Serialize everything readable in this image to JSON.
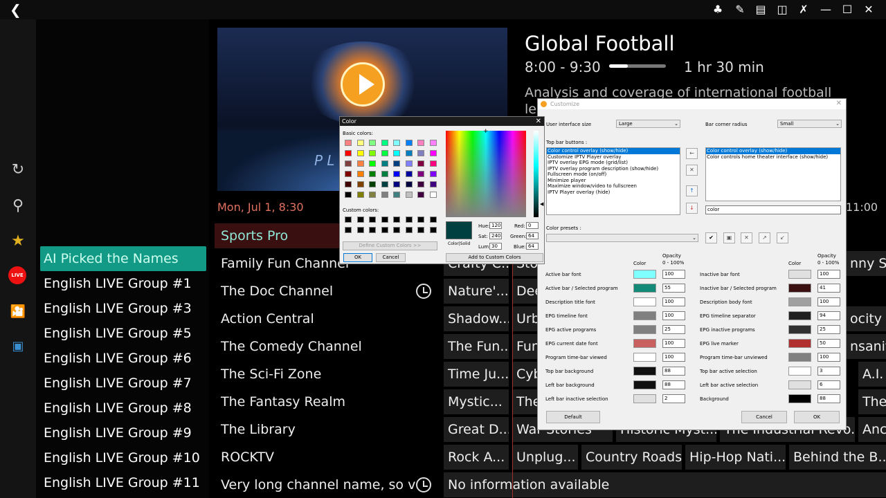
{
  "topbar": {
    "back_icon": "chevron-left-icon",
    "icons": [
      "people-icon",
      "brush-icon",
      "grid-slash-icon",
      "program-icon",
      "shrink-icon",
      "minimize-icon",
      "maximize-icon",
      "close-icon"
    ]
  },
  "leftbar": {
    "icons": [
      "refresh-icon",
      "search-icon",
      "star-icon",
      "live-icon",
      "movies-icon",
      "tv-icon"
    ],
    "live_label": "LIVE"
  },
  "groups": [
    "AI Picked the Names",
    "English LIVE Group #1",
    "English LIVE Group #3",
    "English LIVE Group #5",
    "English LIVE Group #6",
    "English LIVE Group #7",
    "English LIVE Group #8",
    "English LIVE Group #9",
    "English LIVE Group #10",
    "English LIVE Group #11"
  ],
  "program": {
    "title": "Global Football",
    "time": "8:00 - 9:30",
    "duration": "1 hr 30 min",
    "progress": 0.33,
    "description": "Analysis and coverage of international football leagues ar"
  },
  "video": {
    "logo_text": "Z",
    "logo_text2": "P L"
  },
  "epg": {
    "date": "Mon, Jul 1, 8:30",
    "right_time": "11:00",
    "channels": [
      "Sports Pro",
      "Family Fun Channel",
      "The Doc Channel",
      "Action Central",
      "The Comedy Channel",
      "The Sci-Fi Zone",
      "The Fantasy Realm",
      "The Library",
      "ROCKTV",
      "Very long channel name, so v..."
    ],
    "rows": [
      [
        "Crafty C...",
        "Sto",
        "nny Sid"
      ],
      [
        "Nature'...",
        "Dee"
      ],
      [
        "Shadow...",
        "Urb",
        "ocity R"
      ],
      [
        "The Fun...",
        "Fun",
        "nsanity"
      ],
      [
        "Time Ju...",
        "Cyb",
        "A.I."
      ],
      [
        "Mystic...",
        "The",
        "The"
      ],
      [
        "Great D...",
        "War Stories",
        "Historic Myst...",
        "The Industrial Revo...",
        "Anc"
      ],
      [
        "Rock A...",
        "Unplug...",
        "Country Roads",
        "Hip-Hop Nati...",
        "Behind the B..."
      ],
      [
        "No information available"
      ]
    ]
  },
  "colordlg": {
    "title": "Color",
    "basic_label": "Basic colors:",
    "custom_label": "Custom colors:",
    "define_btn": "Define Custom Colors >>",
    "ok": "OK",
    "cancel": "Cancel",
    "colorsolid": "Color|Solid",
    "hue_l": "Hue:",
    "hue": "120",
    "sat_l": "Sat:",
    "sat": "240",
    "lum_l": "Lum:",
    "lum": "30",
    "red_l": "Red:",
    "red": "0",
    "green_l": "Green:",
    "green": "64",
    "blue_l": "Blue:",
    "blue": "64",
    "add_btn": "Add to Custom Colors",
    "selected": "#004040",
    "basic": [
      "#ff8080",
      "#ffff80",
      "#80ff80",
      "#00ff80",
      "#80ffff",
      "#0080ff",
      "#ff80c0",
      "#ff80ff",
      "#ff0000",
      "#ffff00",
      "#80ff00",
      "#00ff40",
      "#00ffff",
      "#0080c0",
      "#8080c0",
      "#ff00ff",
      "#804040",
      "#ff8040",
      "#00ff00",
      "#008080",
      "#004080",
      "#8080ff",
      "#800040",
      "#ff0080",
      "#800000",
      "#ff8000",
      "#008000",
      "#008040",
      "#0000ff",
      "#0000a0",
      "#800080",
      "#8000ff",
      "#400000",
      "#804000",
      "#004000",
      "#004040",
      "#000080",
      "#000040",
      "#400040",
      "#400080",
      "#000000",
      "#808000",
      "#808040",
      "#808080",
      "#408080",
      "#c0c0c0",
      "#400040",
      "#ffffff"
    ]
  },
  "custdlg": {
    "title": "Customize",
    "ui_size_l": "User interface size",
    "ui_size": "Large",
    "corner_l": "Bar corner radius",
    "corner": "Small",
    "topbar_l": "Top bar buttons :",
    "avail": [
      "Color control overlay (show/hide)",
      "Customize IPTV Player overlay",
      "IPTV overlay EPG mode (grid/list)",
      "IPTV overlay program description (show/hide)",
      "Fullscreen mode (on/off)",
      "Minimize player",
      "Maximize window/video to fullscreen",
      "IPTV Player overlay (hide)"
    ],
    "chosen": [
      "Color control overlay (show/hide)",
      "Color controls home theater interface (show/hide)"
    ],
    "search": "color",
    "presets_l": "Color presets :",
    "color_h": "Color",
    "opacity_h": "Opacity",
    "opacity_sub": "0 - 100%",
    "left_rows": [
      [
        "Active bar font",
        "#80ffff",
        "100"
      ],
      [
        "Active bar / Selected program",
        "#138a78",
        "55"
      ],
      [
        "Description title font",
        "#ffffff",
        "100"
      ],
      [
        "EPG timeline font",
        "#808080",
        "100"
      ],
      [
        "EPG active programs",
        "#808080",
        "25"
      ],
      [
        "EPG current date font",
        "#c86060",
        "100"
      ],
      [
        "Program time-bar viewed",
        "#ffffff",
        "100"
      ],
      [
        "Top bar background",
        "#101010",
        "88"
      ],
      [
        "Left bar background",
        "#101010",
        "88"
      ],
      [
        "Left bar inactive selection",
        "#e0e0e0",
        "2"
      ]
    ],
    "right_rows": [
      [
        "Inactive bar font",
        "#e0e0e0",
        "100"
      ],
      [
        "Inactive bar / Selected program",
        "#3a1010",
        "41"
      ],
      [
        "Description body font",
        "#a0a0a0",
        "100"
      ],
      [
        "EPG timeline separator",
        "#202020",
        "94"
      ],
      [
        "EPG inactive programs",
        "#303030",
        "25"
      ],
      [
        "EPG live marker",
        "#b03030",
        "50"
      ],
      [
        "Program time-bar unviewed",
        "#808080",
        "100"
      ],
      [
        "Top bar active selection",
        "#ffffff",
        "3"
      ],
      [
        "Left bar active selection",
        "#e0e0e0",
        "6"
      ],
      [
        "Background",
        "#000000",
        "88"
      ]
    ],
    "default_btn": "Default",
    "cancel_btn": "Cancel",
    "ok_btn": "OK"
  }
}
